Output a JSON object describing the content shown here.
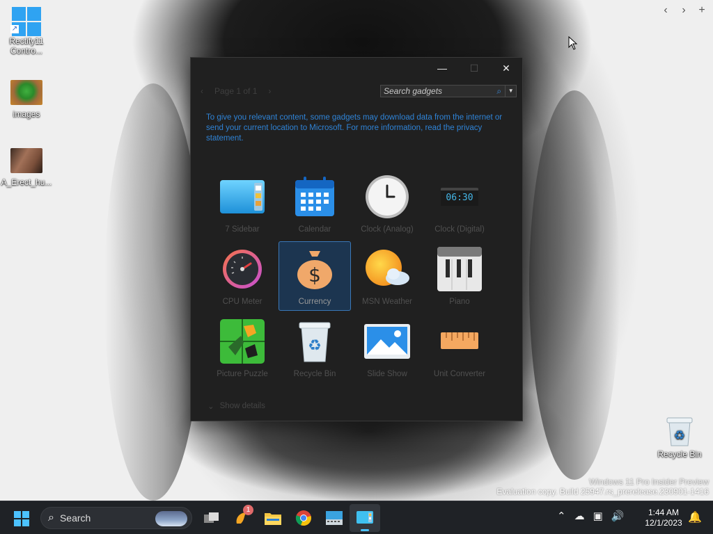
{
  "desktop": {
    "icons": [
      {
        "label_line1": "Rectify11",
        "label_line2": "Contro..."
      },
      {
        "label_line1": "images",
        "label_line2": ""
      },
      {
        "label_line1": "A_Erect_hu...",
        "label_line2": ""
      }
    ],
    "recycle_bin_label": "Recycle Bin",
    "watermark": {
      "line1": "Windows 11 Pro Insider Preview",
      "line2": "Evaluation copy. Build 25947.rs_prerelease.230901-1416"
    }
  },
  "gadget_window": {
    "pager": "Page 1 of 1",
    "search_placeholder": "Search gadgets",
    "notice": "To give you relevant content, some gadgets may download data from the internet or send your current location to Microsoft. For more information, read the privacy statement.",
    "gadgets": [
      {
        "label": "7 Sidebar",
        "icon": "sidebar-icon"
      },
      {
        "label": "Calendar",
        "icon": "calendar-icon"
      },
      {
        "label": "Clock (Analog)",
        "icon": "analog-clock-icon"
      },
      {
        "label": "Clock (Digital)",
        "icon": "digital-clock-icon",
        "display": "06:30"
      },
      {
        "label": "CPU Meter",
        "icon": "cpu-meter-icon"
      },
      {
        "label": "Currency",
        "icon": "currency-icon",
        "selected": true
      },
      {
        "label": "MSN Weather",
        "icon": "weather-icon"
      },
      {
        "label": "Piano",
        "icon": "piano-icon"
      },
      {
        "label": "Picture Puzzle",
        "icon": "puzzle-icon"
      },
      {
        "label": "Recycle Bin",
        "icon": "recycle-bin-icon"
      },
      {
        "label": "Slide Show",
        "icon": "slideshow-icon"
      },
      {
        "label": "Unit Converter",
        "icon": "ruler-icon"
      }
    ],
    "show_details": "Show details"
  },
  "taskbar": {
    "search_label": "Search",
    "notification_count": "1",
    "time": "1:44 AM",
    "date": "12/1/2023"
  },
  "colors": {
    "accent": "#4cc2ff",
    "link_blue": "#2f83d6",
    "dialog_bg": "#202020",
    "selected_bg": "#1c3550"
  }
}
